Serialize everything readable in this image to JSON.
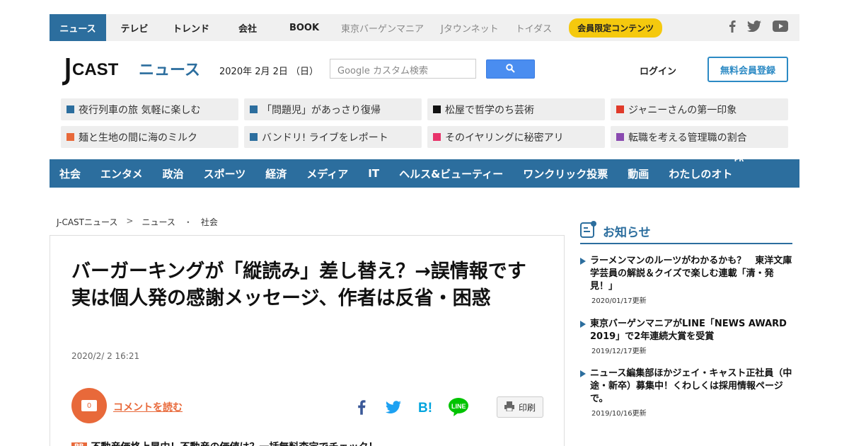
{
  "topbar": {
    "tabs": [
      {
        "label": "ニュース"
      },
      {
        "label": "テレビ"
      },
      {
        "label": "トレンド"
      },
      {
        "label": "会社"
      },
      {
        "label": "BOOK"
      }
    ],
    "sister_sites": [
      {
        "label": "東京バーゲンマニア"
      },
      {
        "label": "Jタウンネット"
      },
      {
        "label": "トイダス"
      }
    ],
    "member_label": "会員限定コンテンツ"
  },
  "header": {
    "logo_text": "J-CAST ニュース",
    "date": "2020年 2月 2日 （日）",
    "search_placeholder": "Google カスタム検索",
    "login_label": "ログイン",
    "register_label": "無料会員登録"
  },
  "topics": [
    {
      "label": "夜行列車の旅 気軽に楽しむ",
      "color": "#2c6e9e"
    },
    {
      "label": "「問題児」があっさり復帰",
      "color": "#2c6e9e"
    },
    {
      "label": "松屋で哲学のち芸術",
      "color": "#111111"
    },
    {
      "label": "ジャニーさんの第一印象",
      "color": "#e03a2a"
    },
    {
      "label": "麺と生地の間に海のミルク",
      "color": "#e8693a"
    },
    {
      "label": "バンドリ! ライブをレポート",
      "color": "#2c6e9e"
    },
    {
      "label": "そのイヤリングに秘密アリ",
      "color": "#e8336a"
    },
    {
      "label": "転職を考える管理職の割合",
      "color": "#8a4ab0"
    }
  ],
  "categories": [
    {
      "label": "社会"
    },
    {
      "label": "エンタメ"
    },
    {
      "label": "政治"
    },
    {
      "label": "スポーツ"
    },
    {
      "label": "経済"
    },
    {
      "label": "メディア"
    },
    {
      "label": "IT"
    },
    {
      "label": "ヘルス&ビューティー"
    },
    {
      "label": "ワンクリック投票"
    },
    {
      "label": "動画"
    },
    {
      "label": "わたしのオト"
    }
  ],
  "category_pr": "PR",
  "breadcrumb": {
    "home": "J-CASTニュース",
    "sep1": ">",
    "section": "ニュース",
    "sep2": "・",
    "category": "社会"
  },
  "article": {
    "headline": "バーガーキングが「縦読み」差し替え？→誤情報です　実は個人発の感謝メッセージ、作者は反省・困惑",
    "posted": "2020/2/ 2 16:21",
    "comment_count": "0",
    "comment_link": "コメントを読む",
    "print_label": "印刷",
    "pr_badge": "PR",
    "pr_text": "不動産価格上昇中！不動産の価値は？一括無料査定でチェック！"
  },
  "sidebar": {
    "title": "お知らせ",
    "items": [
      {
        "text": "ラーメンマンのルーツがわかるかも？　東洋文庫学芸員の解説＆クイズで楽しむ連載「清・発見！」",
        "updated": "2020/01/17更新"
      },
      {
        "text": "東京バーゲンマニアがLINE「NEWS AWARD 2019」で2年連続大賞を受賞",
        "updated": "2019/12/17更新"
      },
      {
        "text": "ニュース編集部ほかジェイ・キャスト正社員（中途・新卒）募集中！くわしくは採用情報ページで。",
        "updated": "2019/10/16更新"
      }
    ]
  },
  "colors": {
    "brand_blue": "#2c6e9e",
    "accent_orange": "#e8693a",
    "member_yellow": "#f5c90e"
  }
}
